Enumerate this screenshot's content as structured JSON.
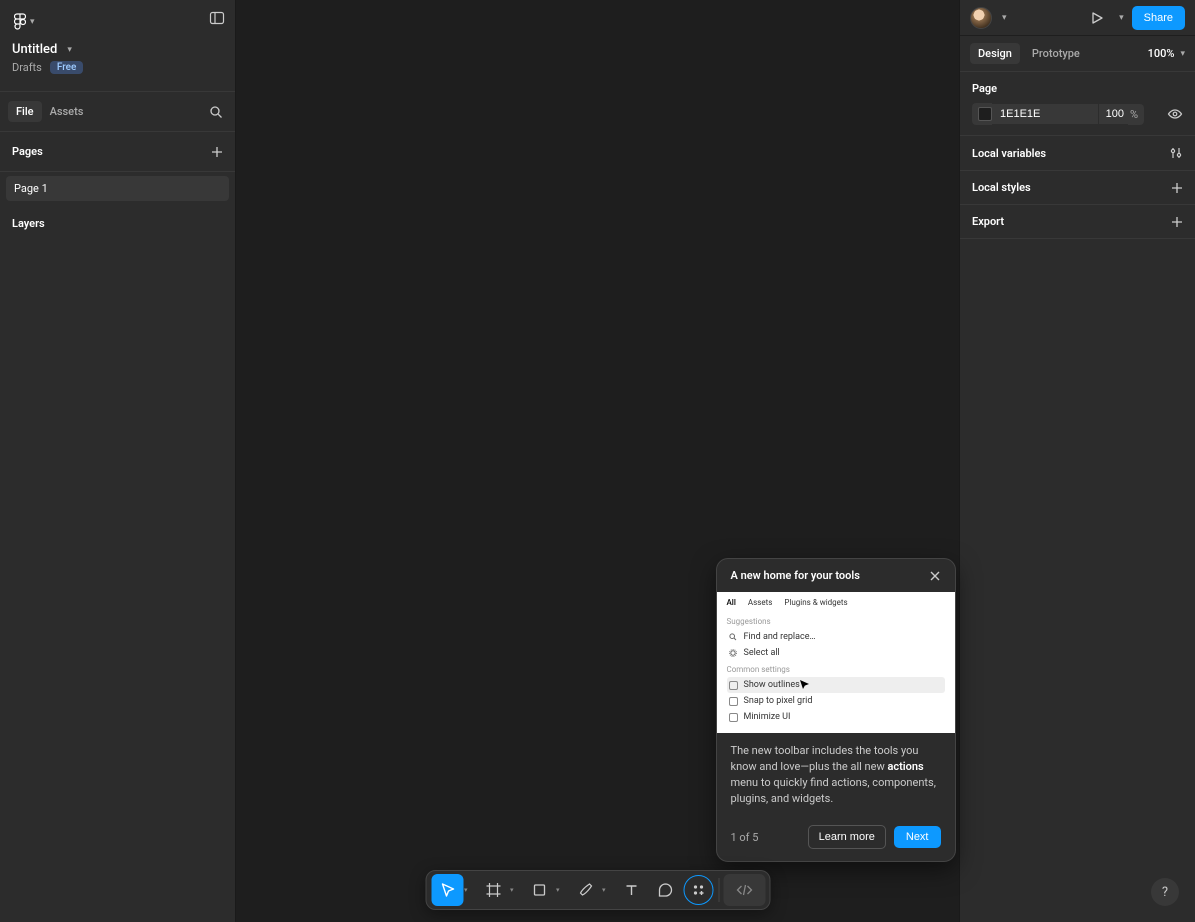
{
  "header": {
    "doc_title": "Untitled",
    "location": "Drafts",
    "free_badge": "Free",
    "share_label": "Share"
  },
  "left_panel": {
    "tabs": {
      "file": "File",
      "assets": "Assets"
    },
    "pages_label": "Pages",
    "pages": [
      "Page 1"
    ],
    "layers_label": "Layers"
  },
  "right_panel": {
    "tabs": {
      "design": "Design",
      "prototype": "Prototype"
    },
    "zoom": "100%",
    "page_section": {
      "label": "Page",
      "color_hex": "1E1E1E",
      "opacity_value": "100",
      "opacity_unit": "%"
    },
    "sections": {
      "local_variables": "Local variables",
      "local_styles": "Local styles",
      "export": "Export"
    }
  },
  "popover": {
    "title": "A new home for your tools",
    "preview": {
      "tabs": [
        "All",
        "Assets",
        "Plugins & widgets"
      ],
      "suggestions_label": "Suggestions",
      "suggestions": [
        "Find and replace…",
        "Select all"
      ],
      "common_label": "Common settings",
      "common": [
        "Show outlines",
        "Snap to pixel grid",
        "Minimize UI"
      ]
    },
    "body_part1": "The new toolbar includes the tools you know and love—plus the all new ",
    "body_bold": "actions",
    "body_part2": " menu to quickly find actions, components, plugins, and widgets.",
    "step": "1 of 5",
    "learn_label": "Learn more",
    "next_label": "Next"
  },
  "help_label": "?"
}
